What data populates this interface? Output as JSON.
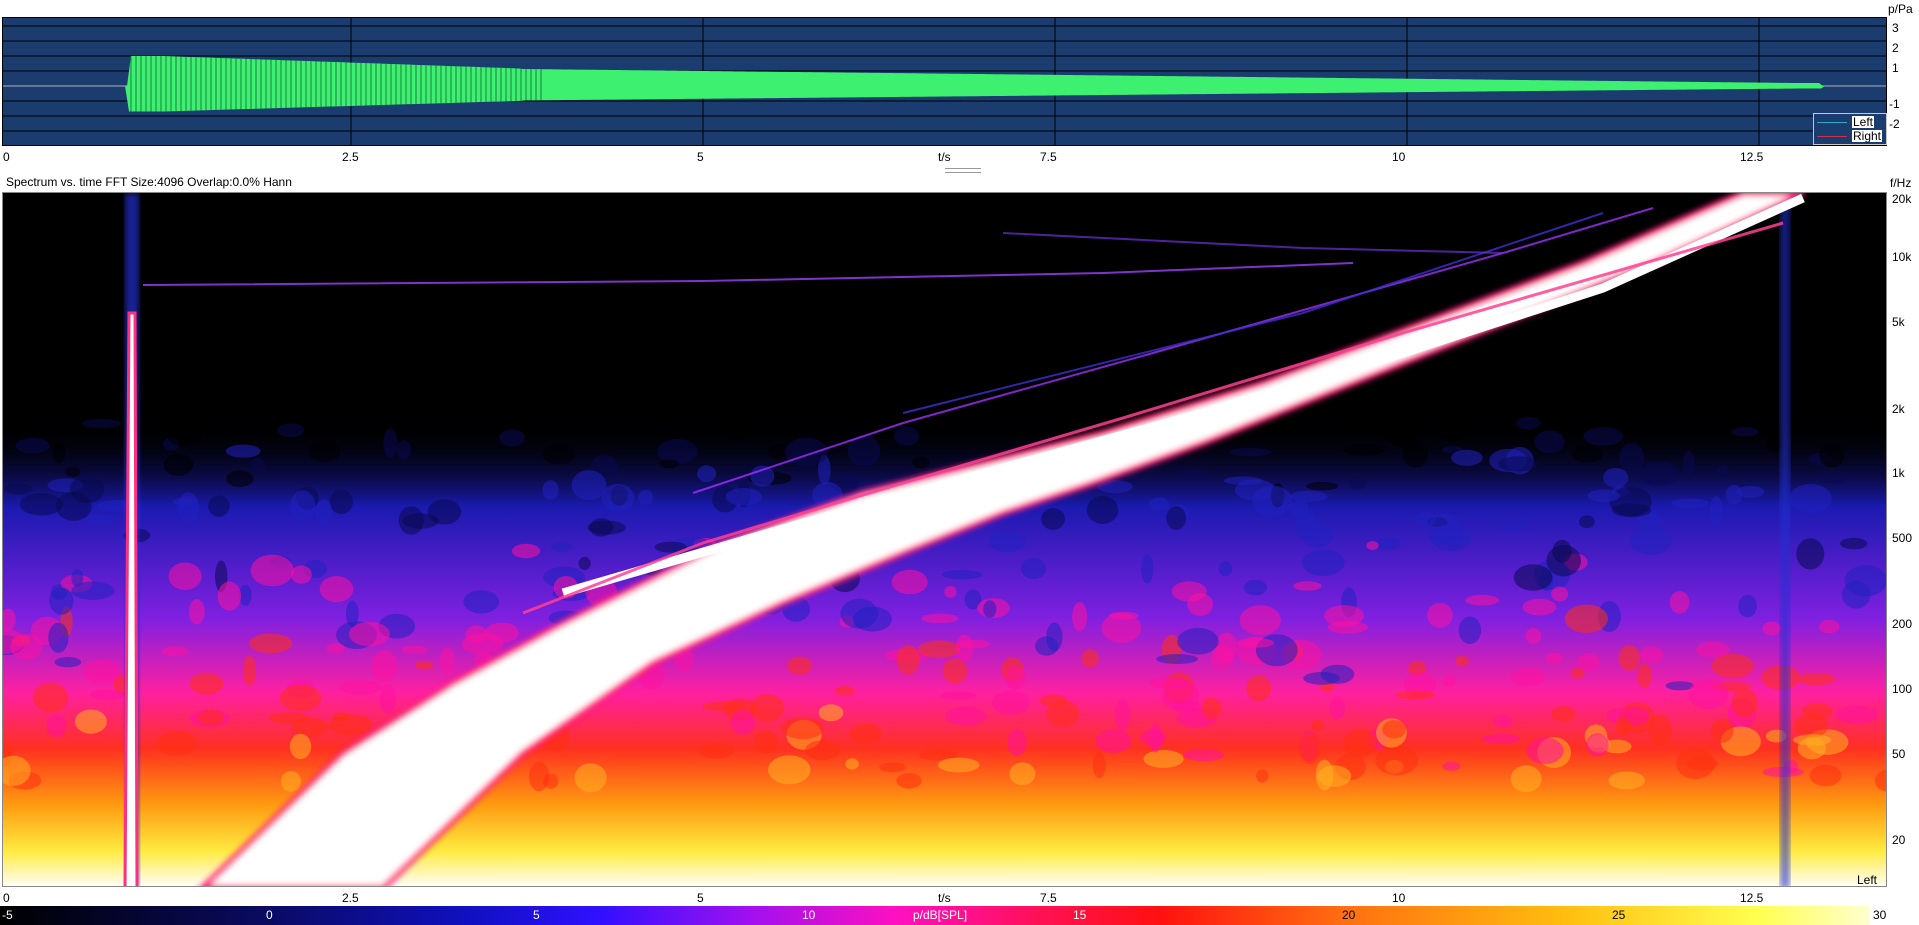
{
  "waveform": {
    "y_unit": "p/Pa",
    "y_ticks": [
      "3",
      "2",
      "1",
      "-1",
      "-2"
    ],
    "x_unit": "t/s",
    "x_ticks": [
      "0",
      "2.5",
      "5",
      "7.5",
      "10",
      "12.5"
    ],
    "legend": [
      {
        "label": "Left",
        "color": "#2aa8c8"
      },
      {
        "label": "Right",
        "color": "#d03050"
      }
    ],
    "trace_color": "#3df070",
    "background_color": "#1b3c6e"
  },
  "spectrogram": {
    "title": "Spectrum vs. time  FFT Size:4096  Overlap:0.0%  Hann",
    "y_unit": "f/Hz",
    "y_ticks": [
      "20k",
      "10k",
      "5k",
      "2k",
      "1k",
      "500",
      "200",
      "100",
      "50",
      "20"
    ],
    "x_unit": "t/s",
    "x_ticks": [
      "0",
      "2.5",
      "5",
      "7.5",
      "10",
      "12.5"
    ],
    "channel": "Left"
  },
  "colorbar": {
    "unit": "p/dB[SPL]",
    "ticks": [
      "-5",
      "0",
      "5",
      "10",
      "15",
      "20",
      "25",
      "30"
    ]
  }
}
